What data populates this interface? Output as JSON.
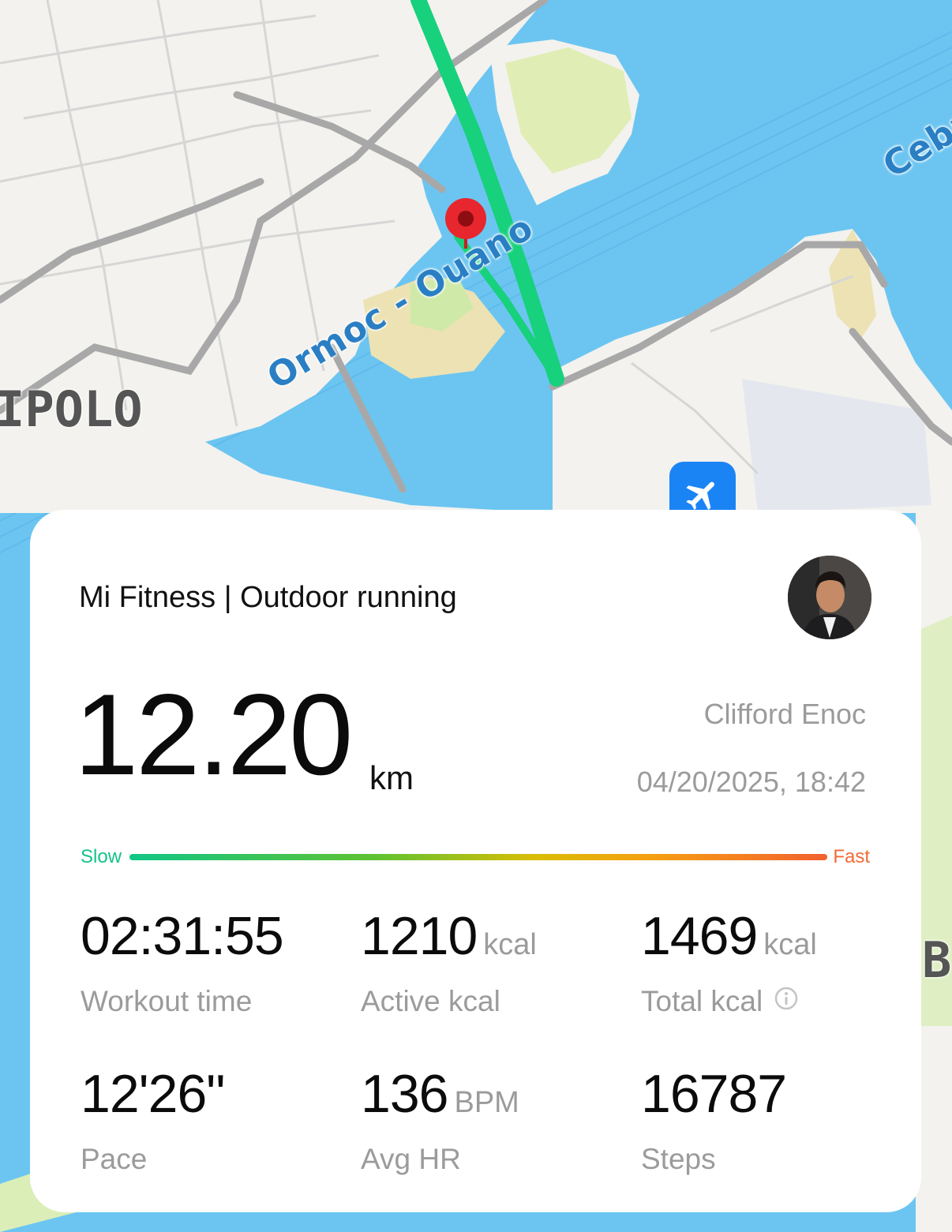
{
  "map": {
    "route_label": "Ormoc - Ouano",
    "route_label_2": "Cebu",
    "district_left": "IPOLO",
    "district_right": "B",
    "colors": {
      "water": "#69c3f0",
      "land": "#f2f1ed",
      "park": "#cfe9a8",
      "route": "#17d17c",
      "pin": "#e8262d"
    }
  },
  "card": {
    "app_title": "Mi Fitness | Outdoor running",
    "distance": "12.20",
    "distance_unit": "km",
    "user_name": "Clifford Enoc",
    "datetime": "04/20/2025, 18:42",
    "speed_slow_label": "Slow",
    "speed_fast_label": "Fast",
    "stats": [
      {
        "value": "02:31:55",
        "unit": "",
        "label": "Workout time"
      },
      {
        "value": "1210",
        "unit": "kcal",
        "label": "Active kcal"
      },
      {
        "value": "1469",
        "unit": "kcal",
        "label": "Total kcal"
      },
      {
        "value": "12'26\"",
        "unit": "",
        "label": "Pace"
      },
      {
        "value": "136",
        "unit": "BPM",
        "label": "Avg HR"
      },
      {
        "value": "16787",
        "unit": "",
        "label": "Steps"
      }
    ]
  }
}
